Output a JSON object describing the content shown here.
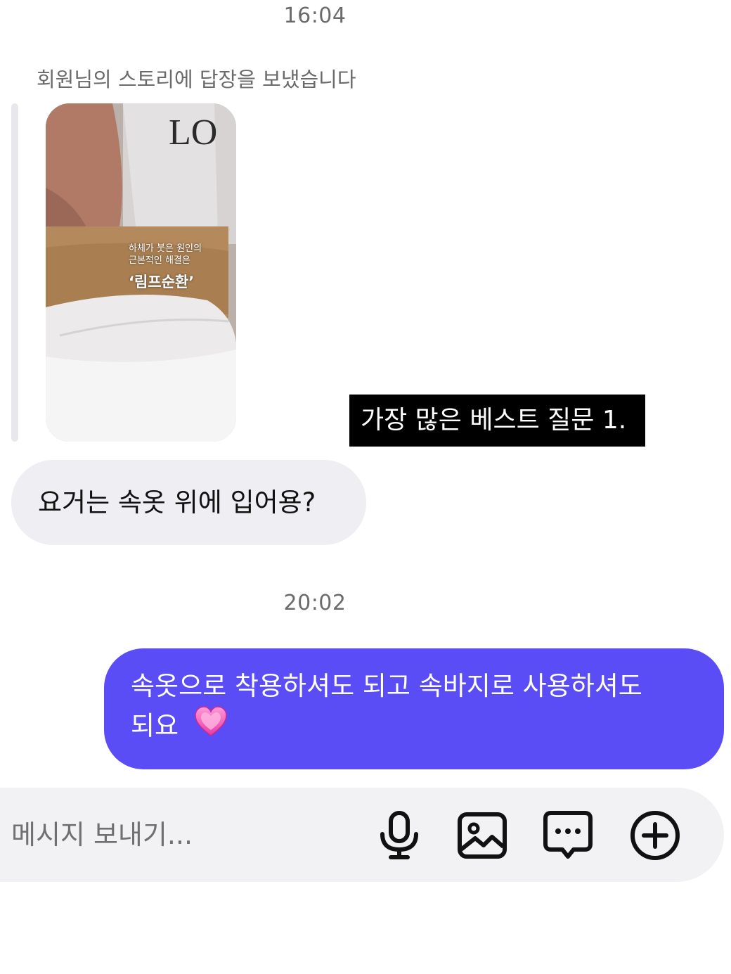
{
  "chat": {
    "timestamp_1": "16:04",
    "story_reply_note": "회원님의 스토리에 답장을 보냈습니다",
    "story": {
      "caption_line_1": "하체가 붓은 원인의",
      "caption_line_2": "근본적인 해결은",
      "headline": "‘림프순환’",
      "brand_mark": "LO"
    },
    "overlay_caption": "가장 많은 베스트 질문 1.",
    "incoming_message": "요거는 속옷 위에 입어용?",
    "timestamp_2": "20:02",
    "outgoing_message_line_1": "속옷으로 착용하셔도 되고 속바지로 사용하셔도",
    "outgoing_message_line_2": "되요",
    "outgoing_emoji": "heart-emoji"
  },
  "composer": {
    "placeholder": "메시지 보내기...",
    "icons": [
      "microphone-icon",
      "image-icon",
      "chat-bubble-icon",
      "plus-circle-icon"
    ]
  },
  "colors": {
    "outgoing_bubble": "#5b4df5",
    "incoming_bubble": "#efeff3",
    "composer_bg": "#f2f2f4"
  }
}
